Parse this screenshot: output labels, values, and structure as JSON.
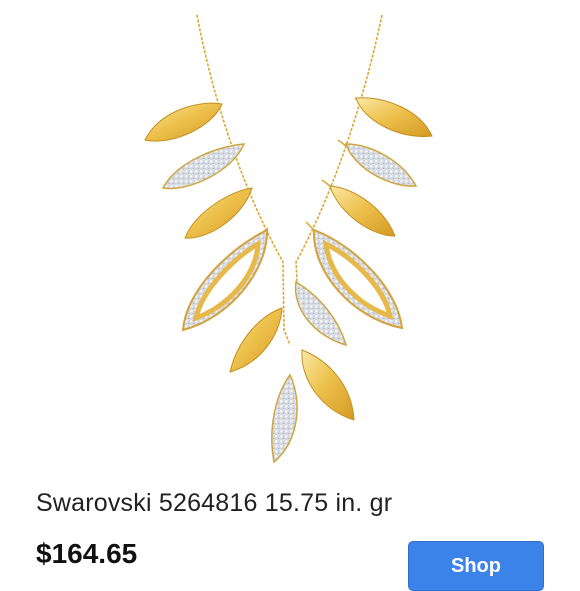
{
  "product": {
    "title": "Swarovski 5264816 15.75 in. gr",
    "price": "$164.65",
    "image_subject": "necklace-image"
  },
  "actions": {
    "shop_label": "Shop"
  },
  "colors": {
    "gold": "#e8b43a",
    "gold_light": "#f6dc86",
    "pave": "#dfe3ea",
    "shop_button": "#3b83e8"
  }
}
